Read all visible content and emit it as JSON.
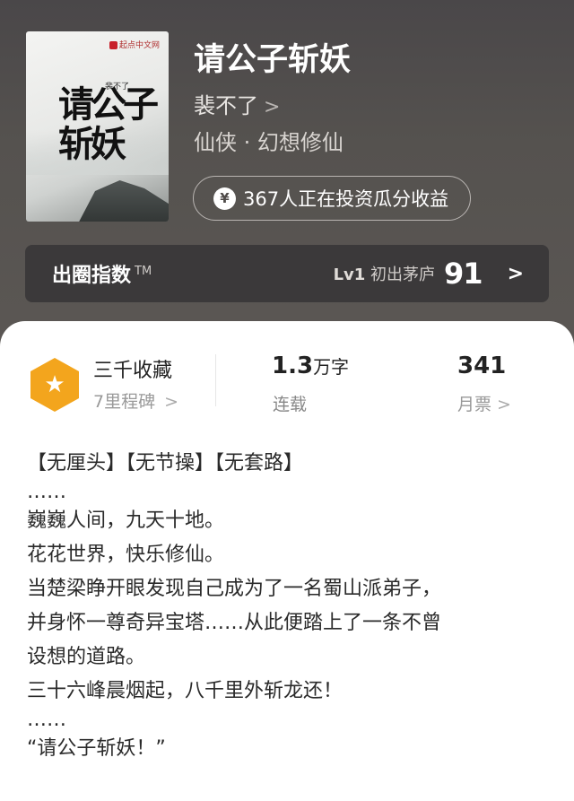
{
  "book": {
    "title": "请公子斩妖",
    "author": "裴不了",
    "genre": "仙侠 · 幻想修仙",
    "invest_text": "367人正在投资瓜分收益",
    "cover": {
      "publisher": "起点中文网",
      "title_art": "请公子斩妖",
      "author_art": "裴不了"
    }
  },
  "circle_index": {
    "label": "出圈指数",
    "trademark": "TM",
    "level_prefix": "Lv1",
    "level_name": "初出茅庐",
    "score": "91"
  },
  "stats": {
    "collect_title": "三千收藏",
    "collect_sub": "7里程碑",
    "words_value": "1.3",
    "words_unit": "万字",
    "words_status": "连载",
    "monthly_value": "341",
    "monthly_label": "月票"
  },
  "description": [
    "【无厘头】【无节操】【无套路】",
    "……",
    "巍巍人间，九天十地。",
    "花花世界，快乐修仙。",
    "当楚梁睁开眼发现自己成为了一名蜀山派弟子，",
    "并身怀一尊奇异宝塔……从此便踏上了一条不曾",
    "设想的道路。",
    "三十六峰晨烟起，八千里外斩龙还！",
    "……",
    "“请公子斩妖！”"
  ],
  "icons": {
    "badge": "star-hexagon-icon",
    "yen": "yen-coin-icon",
    "chevron": "chevron-right-icon"
  },
  "colors": {
    "hero_bg": "#55524f",
    "badge": "#f3a51d",
    "card_bg": "#ffffff"
  }
}
